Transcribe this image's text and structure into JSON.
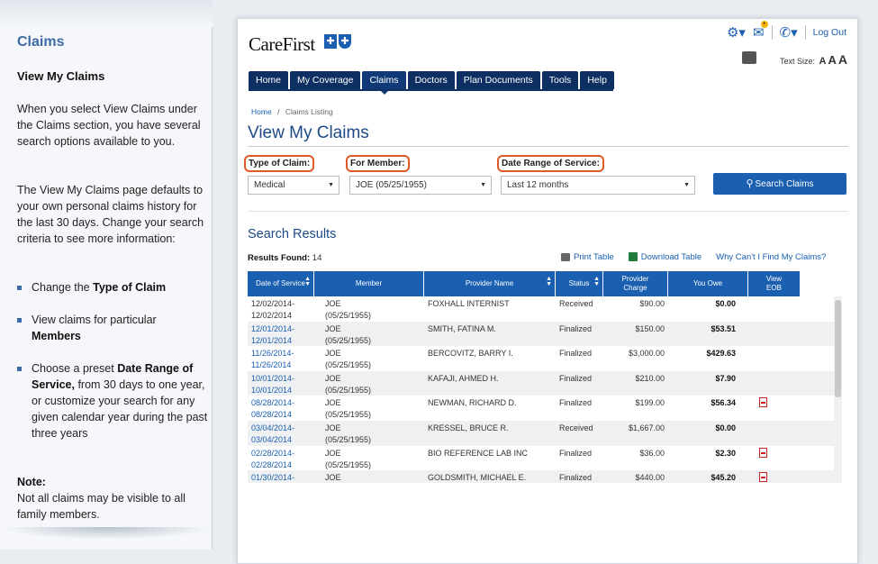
{
  "help": {
    "title": "Claims",
    "subtitle": "View My Claims",
    "intro": "When you select View Claims under the Claims section, you have several search options available to you.",
    "para2": "The View My Claims page defaults to your own personal claims history for the last 30 days. Change your search criteria to see more information:",
    "bullets": [
      {
        "pre": "Change the ",
        "bold": "Type of Claim",
        "post": ""
      },
      {
        "pre": "View claims for particular ",
        "bold": "Members",
        "post": ""
      },
      {
        "pre": "Choose a preset ",
        "bold": "Date Range of Service,",
        "post": " from 30 days to one year, or customize your search for any given calendar year during the past three years"
      }
    ],
    "note_title": "Note:",
    "note_text": "Not all claims may be visible to all family members."
  },
  "header": {
    "logo": "CareFirst",
    "logout": "Log Out",
    "text_size_label": "Text Size:",
    "text_sizes": [
      "A",
      "A",
      "A"
    ]
  },
  "nav": {
    "tabs": [
      "Home",
      "My Coverage",
      "Claims",
      "Doctors",
      "Plan Documents",
      "Tools",
      "Help"
    ],
    "active": "Claims"
  },
  "breadcrumb": {
    "home": "Home",
    "sep": "/",
    "current": "Claims Listing"
  },
  "page_title": "View My Claims",
  "filters": {
    "type_label": "Type of Claim:",
    "type_value": "Medical",
    "member_label": "For Member:",
    "member_value": "JOE (05/25/1955)",
    "range_label": "Date Range of Service:",
    "range_value": "Last 12 months",
    "search_button": "Search Claims"
  },
  "results": {
    "title": "Search Results",
    "found_label": "Results Found:",
    "found_count": "14",
    "print": "Print Table",
    "download": "Download Table",
    "why": "Why Can't I Find My Claims?",
    "columns": [
      "Date of Service",
      "Member",
      "Provider Name",
      "Status",
      "Provider Charge",
      "You Owe",
      "View EOB"
    ],
    "rows": [
      {
        "d1": "12/02/2014-",
        "d2": "12/02/2014",
        "m1": "JOE",
        "m2": "(05/25/1955)",
        "provider": "FOXHALL INTERNIST",
        "status": "Received",
        "charge": "$90.00",
        "owe": "$0.00",
        "eob": false
      },
      {
        "d1": "12/01/2014-",
        "d2": "12/01/2014",
        "m1": "JOE",
        "m2": "(05/25/1955)",
        "provider": "SMITH, FATINA M.",
        "status": "Finalized",
        "charge": "$150.00",
        "owe": "$53.51",
        "eob": false
      },
      {
        "d1": "11/26/2014-",
        "d2": "11/26/2014",
        "m1": "JOE",
        "m2": "(05/25/1955)",
        "provider": "BERCOVITZ, BARRY I.",
        "status": "Finalized",
        "charge": "$3,000.00",
        "owe": "$429.63",
        "eob": false
      },
      {
        "d1": "10/01/2014-",
        "d2": "10/01/2014",
        "m1": "JOE",
        "m2": "(05/25/1955)",
        "provider": "KAFAJI, AHMED H.",
        "status": "Finalized",
        "charge": "$210.00",
        "owe": "$7.90",
        "eob": false
      },
      {
        "d1": "08/28/2014-",
        "d2": "08/28/2014",
        "m1": "JOE",
        "m2": "(05/25/1955)",
        "provider": "NEWMAN, RICHARD D.",
        "status": "Finalized",
        "charge": "$199.00",
        "owe": "$56.34",
        "eob": true
      },
      {
        "d1": "03/04/2014-",
        "d2": "03/04/2014",
        "m1": "JOE",
        "m2": "(05/25/1955)",
        "provider": "KRESSEL, BRUCE R.",
        "status": "Received",
        "charge": "$1,667.00",
        "owe": "$0.00",
        "eob": false
      },
      {
        "d1": "02/28/2014-",
        "d2": "02/28/2014",
        "m1": "JOE",
        "m2": "(05/25/1955)",
        "provider": "BIO REFERENCE LAB INC",
        "status": "Finalized",
        "charge": "$36.00",
        "owe": "$2.30",
        "eob": true
      },
      {
        "d1": "01/30/2014-",
        "d2": "",
        "m1": "JOE",
        "m2": "",
        "provider": "GOLDSMITH, MICHAEL E.",
        "status": "Finalized",
        "charge": "$440.00",
        "owe": "$45.20",
        "eob": true
      }
    ]
  }
}
